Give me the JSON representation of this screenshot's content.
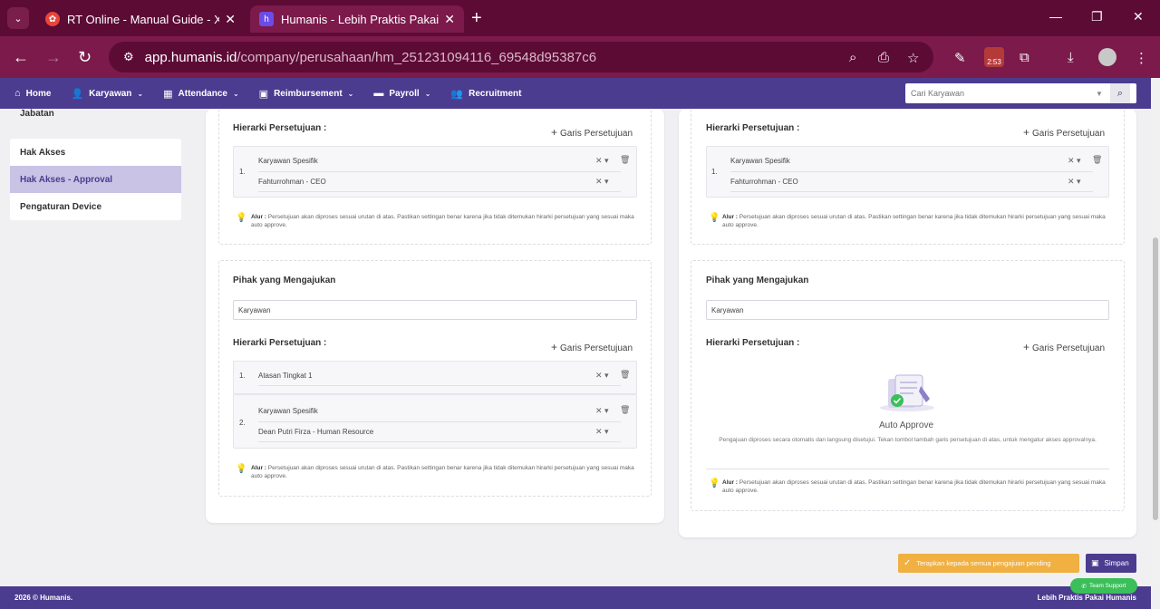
{
  "browser": {
    "tabs": [
      {
        "title": "RT Online - Manual Guide - Xm"
      },
      {
        "title": "Humanis - Lebih Praktis Pakai H"
      }
    ],
    "url_host": "app.humanis.id",
    "url_path": "/company/perusahaan/hm_251231094116_69548d95387c6",
    "ext_badge": "2:53"
  },
  "nav": {
    "items": [
      "Home",
      "Karyawan",
      "Attendance",
      "Reimbursement",
      "Payroll",
      "Recruitment"
    ],
    "search_placeholder": "Cari Karyawan"
  },
  "sidebar": {
    "top_item": "Jabatan",
    "items": [
      "Hak Akses",
      "Hak Akses - Approval",
      "Pengaturan Device"
    ]
  },
  "labels": {
    "hierarki": "Hierarki Persetujuan :",
    "add_line": "Garis Persetujuan",
    "pihak": "Pihak yang Mengajukan",
    "alur": "Alur :",
    "alur_text": "Persetujuan akan diproses sesuai urutan di atas. Pastikan settingan benar karena jika tidak ditemukan hirarki persetujuan yang sesuai maka auto approve.",
    "auto_title": "Auto Approve",
    "auto_desc": "Pengajuan diproses secara otomatis dan langsung disetujui. Tekan tombol tambah garis persetujuan di atas, untuk mengatur akses approvalnya."
  },
  "left": {
    "top_rows": [
      {
        "num": "1.",
        "type": "Karyawan Spesifik",
        "person": "Fahturrohman - CEO"
      }
    ],
    "pihak_value": "Karyawan",
    "rows": [
      {
        "num": "1.",
        "type": "Atasan Tingkat 1"
      },
      {
        "num": "2.",
        "type": "Karyawan Spesifik",
        "person": "Dean Putri Firza - Human Resource"
      }
    ]
  },
  "right": {
    "top_rows": [
      {
        "num": "1.",
        "type": "Karyawan Spesifik",
        "person": "Fahturrohman - CEO"
      }
    ],
    "pihak_value": "Karyawan"
  },
  "actions": {
    "apply_label": "Terapkan kepada semua pengajuan pending",
    "save_label": "Simpan",
    "support_label": "Team Support"
  },
  "footer": {
    "left": "2026 © Humanis.",
    "right": "Lebih Praktis Pakai Humanis"
  },
  "colors": {
    "brand": "#4b3c8f",
    "browser": "#7b1a4b",
    "apply": "#f0b042",
    "support": "#3bbf5a"
  }
}
